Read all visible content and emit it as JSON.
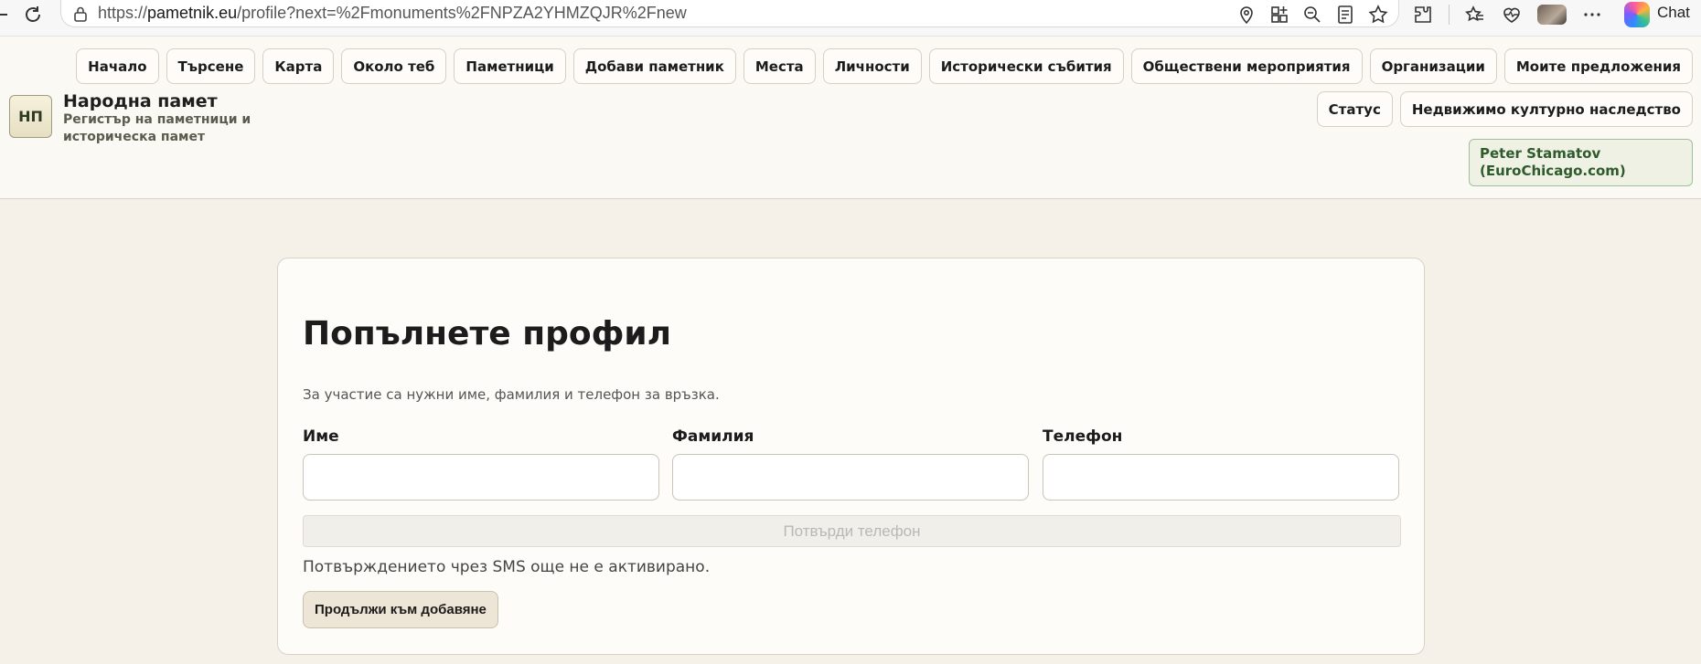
{
  "browser": {
    "url_prefix": "https://",
    "url_domain": "pametnik.eu",
    "url_path": "/profile?next=%2Fmonuments%2FNPZA2YHMZQJR%2Fnew",
    "chat_label": "Chat"
  },
  "site": {
    "logo_text": "НП",
    "title": "Народна памет",
    "subtitle": "Регистър на паметници и историческа памет"
  },
  "nav": {
    "row1": [
      "Начало",
      "Търсене",
      "Карта",
      "Около теб",
      "Паметници",
      "Добави паметник",
      "Места",
      "Личности",
      "Исторически събития",
      "Обществени мероприятия",
      "Организации",
      "Моите предложения"
    ],
    "row2": [
      "Статус",
      "Недвижимо културно наследство"
    ]
  },
  "user": {
    "name": "Peter Stamatov (EuroChicago.com)"
  },
  "form": {
    "title": "Попълнете профил",
    "description": "За участие са нужни име, фамилия и телефон за връзка.",
    "first_name_label": "Име",
    "last_name_label": "Фамилия",
    "phone_label": "Телефон",
    "first_name_value": "",
    "last_name_value": "",
    "phone_value": "",
    "verify_button": "Потвърди телефон",
    "sms_note": "Потвърждението чрез SMS още не е активирано.",
    "continue_button": "Продължи към добавяне"
  }
}
